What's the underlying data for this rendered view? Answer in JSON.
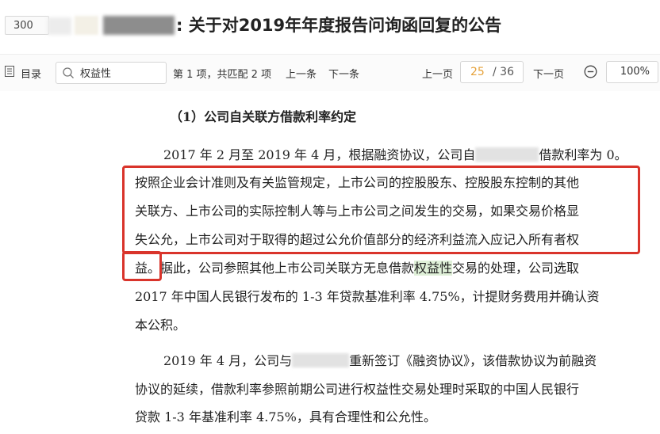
{
  "header": {
    "stock_code_visible": "300",
    "title": ": 关于对2019年年度报告问询函回复的公告"
  },
  "toolbar": {
    "toc_label": "目录",
    "search_value": "权益性",
    "match_info": "第 1 项，共匹配 2 项",
    "prev_match": "上一条",
    "next_match": "下一条",
    "prev_page": "上一页",
    "current_page": "25",
    "total_pages": "/ 36",
    "next_page": "下一页",
    "zoom": "100%"
  },
  "document": {
    "heading": "（1）公司自关联方借款利率约定",
    "p1_l1_a": "2017 年 2 月至 2019 年 4 月，根据融资协议，公司自",
    "p1_l1_b": "借款利率为 0。",
    "p1_l2": "按照企业会计准则及有关监管规定，上市公司的控股股东、控股股东控制的其他",
    "p1_l3": "关联方、上市公司的实际控制人等与上市公司之间发生的交易，如果交易价格显",
    "p1_l4": "失公允，上市公司对于取得的超过公允价值部分的经济利益流入应记入所有者权",
    "p1_l5_a": "益。",
    "p1_l5_b": "据此，公司参照其他上市公司关联方无息借款",
    "p1_l5_hl": "权益性",
    "p1_l5_c": "交易的处理，公司选取",
    "p1_l6": "2017 年中国人民银行发布的 1-3 年贷款基准利率 4.75%，计提财务费用并确认资",
    "p1_l7": "本公积。",
    "p2_l1_a": "2019 年 4 月，公司与",
    "p2_l1_b": "重新签订《融资协议》，该借款协议为前融资",
    "p2_l2": "协议的延续，借款利率参照前期公司进行权益性交易处理时采取的中国人民银行",
    "p2_l3": "贷款 1-3 年基准利率 4.75%，具有合理性和公允性。"
  },
  "colors": {
    "annotation_red": "#d9342b",
    "search_highlight": "#dff0d8",
    "page_number": "#e5a13a"
  }
}
